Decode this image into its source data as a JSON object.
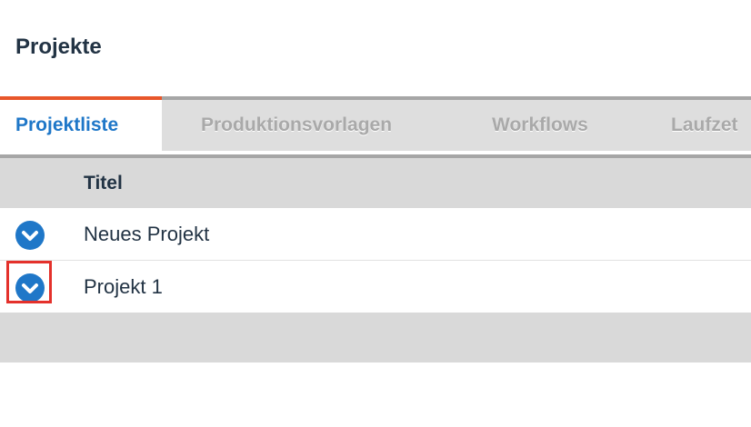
{
  "page": {
    "title": "Projekte"
  },
  "tabs": [
    {
      "label": "Projektliste",
      "active": true
    },
    {
      "label": "Produktionsvorlagen",
      "active": false
    },
    {
      "label": "Workflows",
      "active": false
    },
    {
      "label": "Laufzet",
      "active": false
    }
  ],
  "table": {
    "columns": [
      "Titel"
    ],
    "rows": [
      {
        "title": "Neues Projekt",
        "icon": "chevron-down-circle-icon"
      },
      {
        "title": "Projekt 1",
        "icon": "chevron-down-circle-icon",
        "highlighted": true
      }
    ]
  },
  "colors": {
    "accent_blue": "#1f77c8",
    "active_tab_line": "#e8562a",
    "highlight_red": "#e4312b",
    "title_text": "#223344"
  }
}
